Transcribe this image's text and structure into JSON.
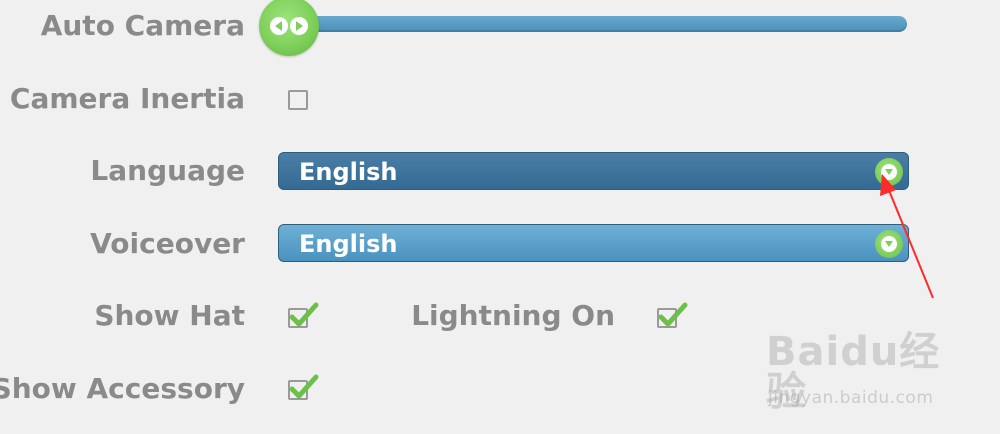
{
  "settings": {
    "auto_camera": {
      "label": "Auto Camera",
      "slider_level": 0.0
    },
    "camera_inertia": {
      "label": "Camera Inertia",
      "checked": false
    },
    "language": {
      "label": "Language",
      "value": "English"
    },
    "voiceover": {
      "label": "Voiceover",
      "value": "English"
    },
    "show_hat": {
      "label": "Show Hat",
      "checked": true
    },
    "lightning_on": {
      "label": "Lightning On",
      "checked": true
    },
    "show_accessory": {
      "label": "Show Accessory",
      "checked": true
    }
  },
  "watermark": {
    "brand": "Baidu经验",
    "url": "jingyan.baidu.com"
  },
  "colors": {
    "label_gray": "#8a8a8a",
    "slider_blue": "#4a8fb8",
    "dropdown_dark": "#346a93",
    "dropdown_light": "#4b92bf",
    "accent_green": "#7fd05b",
    "annotation_red": "#ff2a2a"
  },
  "icons": {
    "slider_knob": "left-right-arrows-icon",
    "dropdown_button": "chevron-down-icon",
    "check": "check-icon"
  }
}
